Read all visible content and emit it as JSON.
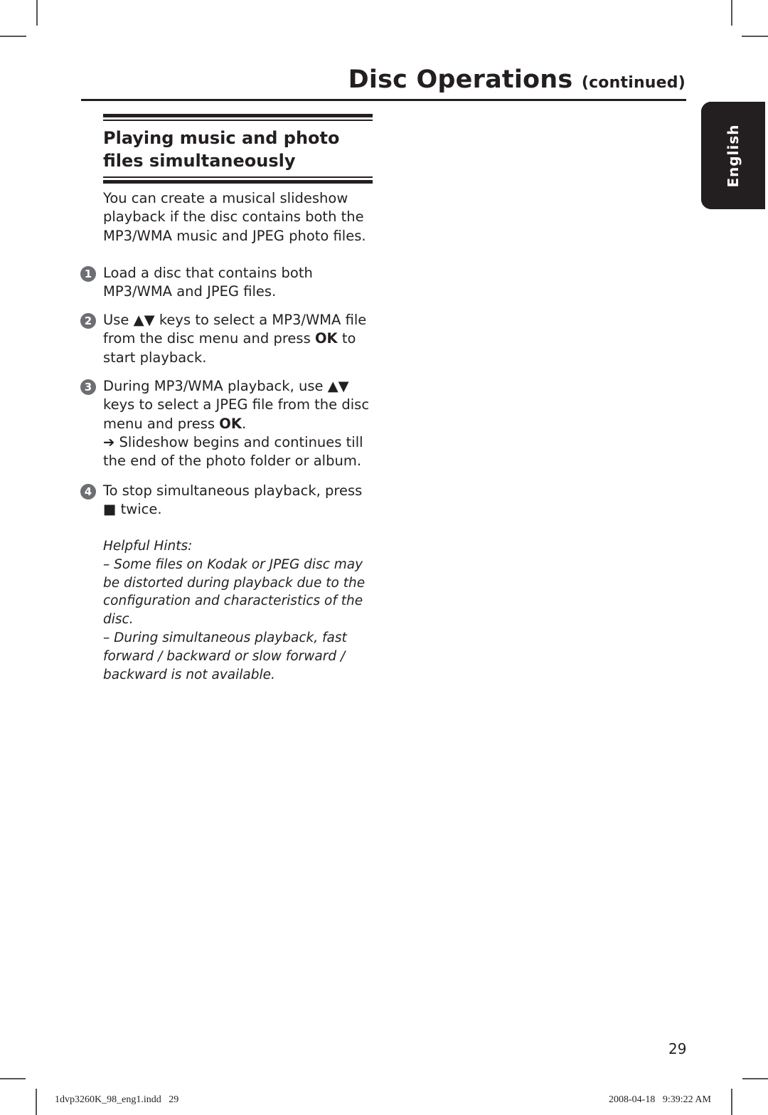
{
  "header": {
    "title": "Disc Operations",
    "continued": "(continued)"
  },
  "language_tab": "English",
  "section": {
    "title": " Playing music and photo files simultaneously"
  },
  "intro": "You can create a musical slideshow playback if the disc contains both the MP3/WMA music and JPEG photo files.",
  "steps": [
    {
      "number": "1",
      "text": "Load a disc that contains both MP3/WMA and JPEG files."
    },
    {
      "number": "2",
      "pre": "Use ",
      "keys": "▲▼",
      "mid": " keys to select a MP3/WMA file from the disc menu and press ",
      "bold": "OK",
      "post": " to start playback."
    },
    {
      "number": "3",
      "pre": "During MP3/WMA playback, use ",
      "keys": "▲▼",
      "mid": " keys to select a JPEG file from the disc menu and press ",
      "bold": "OK",
      "post": ".",
      "result_arrow": "➔",
      "result": " Slideshow begins and continues till the end of the photo folder or album."
    },
    {
      "number": "4",
      "pre": "To stop simultaneous playback, press ",
      "keys": "■",
      "post": " twice."
    }
  ],
  "hints": {
    "title": "Helpful Hints:",
    "items": [
      "–  Some files on Kodak or JPEG disc may be distorted during playback due to the configuration and characteristics of the disc.",
      "–  During simultaneous playback, fast forward / backward or slow forward / backward is not available."
    ]
  },
  "page_number": "29",
  "slug": {
    "file": "1dvp3260K_98_eng1.indd   29",
    "timestamp": "2008-04-18   9:39:22 AM"
  }
}
